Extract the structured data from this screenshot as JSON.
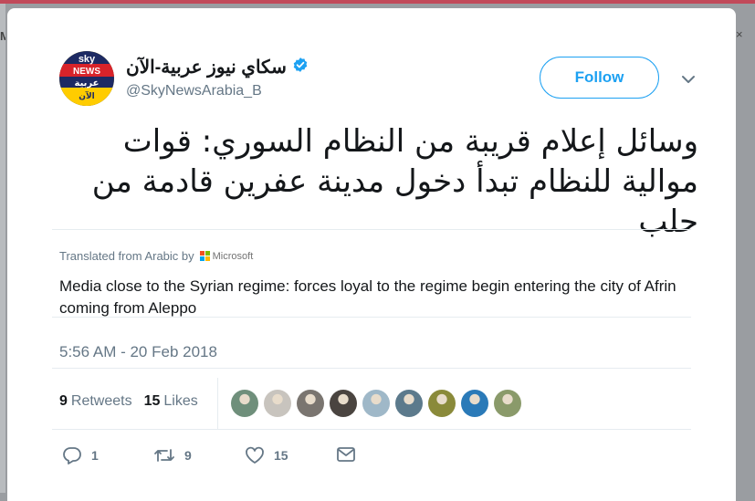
{
  "page": {
    "left_edge_glyph": "M",
    "right_edge_glyph": "×"
  },
  "tweet": {
    "author": {
      "display_name": "سكاي نيوز عربية-الآن",
      "handle": "@SkyNewsArabia_B",
      "verified": true,
      "avatar_lines": [
        "sky",
        "NEWS",
        "عربية",
        "الآن"
      ]
    },
    "follow_label": "Follow",
    "text_lines": [
      "وسائل إعلام قريبة من النظام السوري: قوات",
      "موالية للنظام تبدأ دخول مدينة عفرين قادمة من",
      "حلب"
    ],
    "translation_label": "Translated from Arabic by",
    "translation_provider": "Microsoft",
    "translation": "Media close to the Syrian regime: forces loyal to the regime begin entering the city of Afrin coming from Aleppo",
    "timestamp": "5:56 AM - 20 Feb 2018",
    "stats": {
      "retweets_count": "9",
      "retweets_label": "Retweets",
      "likes_count": "15",
      "likes_label": "Likes"
    },
    "liker_faces": [
      "#6f8f7b",
      "#c8c4be",
      "#7a7570",
      "#4a4440",
      "#9fb8c8",
      "#5c7a8c",
      "#8a8a3a",
      "#2a7ab8",
      "#8a9a6a"
    ],
    "actions": {
      "replies": "1",
      "retweets": "9",
      "likes": "15"
    }
  },
  "colors": {
    "accent": "#1da1f2",
    "text": "#14171a",
    "muted": "#657786",
    "verified": "#1da1f2"
  }
}
